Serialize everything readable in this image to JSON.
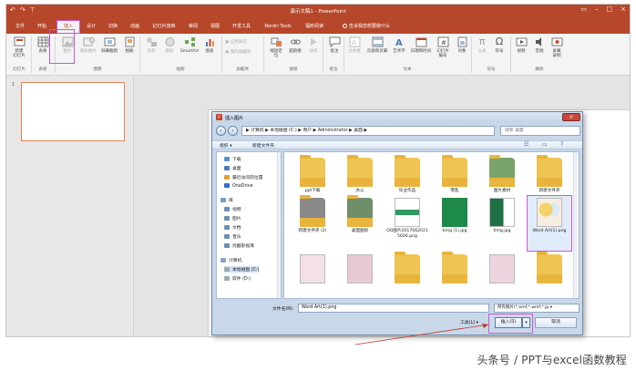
{
  "titlebar": {
    "title": "演示文稿1 - PowerPoint",
    "undo_icon": "undo-icon",
    "redo_icon": "redo-icon"
  },
  "tabs": [
    {
      "label": "文件"
    },
    {
      "label": "开始"
    },
    {
      "label": "插入",
      "active": true
    },
    {
      "label": "设计"
    },
    {
      "label": "切换"
    },
    {
      "label": "动画"
    },
    {
      "label": "幻灯片放映"
    },
    {
      "label": "审阅"
    },
    {
      "label": "视图"
    },
    {
      "label": "开发工具"
    },
    {
      "label": "Nordri Tools"
    },
    {
      "label": "福昕阅读"
    }
  ],
  "tellme": "告诉我您想要做什么",
  "ribbon": {
    "buttons": [
      {
        "label": "新建\n幻灯片"
      },
      {
        "label": "表格"
      },
      {
        "label": "图片"
      },
      {
        "label": "联机图片"
      },
      {
        "label": "屏幕截图"
      },
      {
        "label": "相册"
      },
      {
        "label": "形状"
      },
      {
        "label": "图标"
      },
      {
        "label": "SmartArt"
      },
      {
        "label": "图表"
      },
      {
        "label": "应用商店"
      },
      {
        "label": "我的加载项"
      },
      {
        "label": "缩放定\n位"
      },
      {
        "label": "超链接"
      },
      {
        "label": "动作"
      },
      {
        "label": "批注"
      },
      {
        "label": "文本框"
      },
      {
        "label": "页眉和页脚"
      },
      {
        "label": "艺术字"
      },
      {
        "label": "日期和时间"
      },
      {
        "label": "幻灯片\n编号"
      },
      {
        "label": "对象"
      },
      {
        "label": "公式"
      },
      {
        "label": "符号"
      },
      {
        "label": "视频"
      },
      {
        "label": "音频"
      },
      {
        "label": "屏幕\n录制"
      }
    ],
    "groups": [
      "幻灯片",
      "表格",
      "图像",
      "插图",
      "加载项",
      "链接",
      "批注",
      "文本",
      "符号",
      "媒体"
    ]
  },
  "thumbnails": {
    "slide_number": "1"
  },
  "dialog": {
    "title": "插入图片",
    "address": "▶ 计算机 ▶ 本地磁盘 (C:) ▶ 用户 ▶ Administrator ▶ 桌面 ▶",
    "search_placeholder": "搜索 桌面",
    "commands": {
      "organize": "组织 ▾",
      "new_folder": "新建文件夹"
    },
    "nav": [
      {
        "label": "下载",
        "icon": "download-folder-icon"
      },
      {
        "label": "桌面",
        "icon": "desktop-folder-icon"
      },
      {
        "label": "最近访问的位置",
        "icon": "recent-places-icon"
      },
      {
        "label": "OneDrive",
        "icon": "onedrive-icon"
      },
      {
        "label": "库",
        "icon": "library-icon"
      },
      {
        "label": "视频",
        "icon": "video-library-icon"
      },
      {
        "label": "图片",
        "icon": "picture-library-icon"
      },
      {
        "label": "文档",
        "icon": "document-library-icon"
      },
      {
        "label": "音乐",
        "icon": "music-library-icon"
      },
      {
        "label": "优酷影视库",
        "icon": "youku-library-icon"
      },
      {
        "label": "计算机",
        "icon": "computer-icon"
      },
      {
        "label": "本地磁盘 (C:)",
        "icon": "drive-icon"
      },
      {
        "label": "软件 (D:)",
        "icon": "drive-icon"
      }
    ],
    "files": [
      {
        "label": "ppt下载",
        "kind": "folder"
      },
      {
        "label": "办公",
        "kind": "folder"
      },
      {
        "label": "毕业作品",
        "kind": "folder"
      },
      {
        "label": "零乱",
        "kind": "folder"
      },
      {
        "label": "图片素材",
        "kind": "folder"
      },
      {
        "label": "新建文件夹",
        "kind": "folder"
      },
      {
        "label": "新建文件夹 (2)",
        "kind": "folder"
      },
      {
        "label": "桌面图标",
        "kind": "folder"
      },
      {
        "label": "QQ图片20170620215606.png",
        "kind": "image"
      },
      {
        "label": "timg (1).jpg",
        "kind": "image"
      },
      {
        "label": "timg.jpg",
        "kind": "image"
      },
      {
        "label": "Word Art(1).png",
        "kind": "image",
        "selected": true
      },
      {
        "label": "",
        "kind": "image"
      },
      {
        "label": "",
        "kind": "image"
      },
      {
        "label": "",
        "kind": "folder"
      },
      {
        "label": "",
        "kind": "folder"
      },
      {
        "label": "",
        "kind": "image"
      },
      {
        "label": "",
        "kind": "folder"
      }
    ],
    "filename_label": "文件名(N):",
    "filename_value": "Word Art(1).png",
    "filetype_value": "所有图片(*.emf;*.wmf;*.jp ▾",
    "tools_label": "工具(L) ▾",
    "insert_label": "插入(S)",
    "cancel_label": "取消"
  },
  "watermark": "头条号 / PPT与excel函数教程",
  "colors": {
    "accent": "#b7472a",
    "highlight": "#ce55d6"
  }
}
